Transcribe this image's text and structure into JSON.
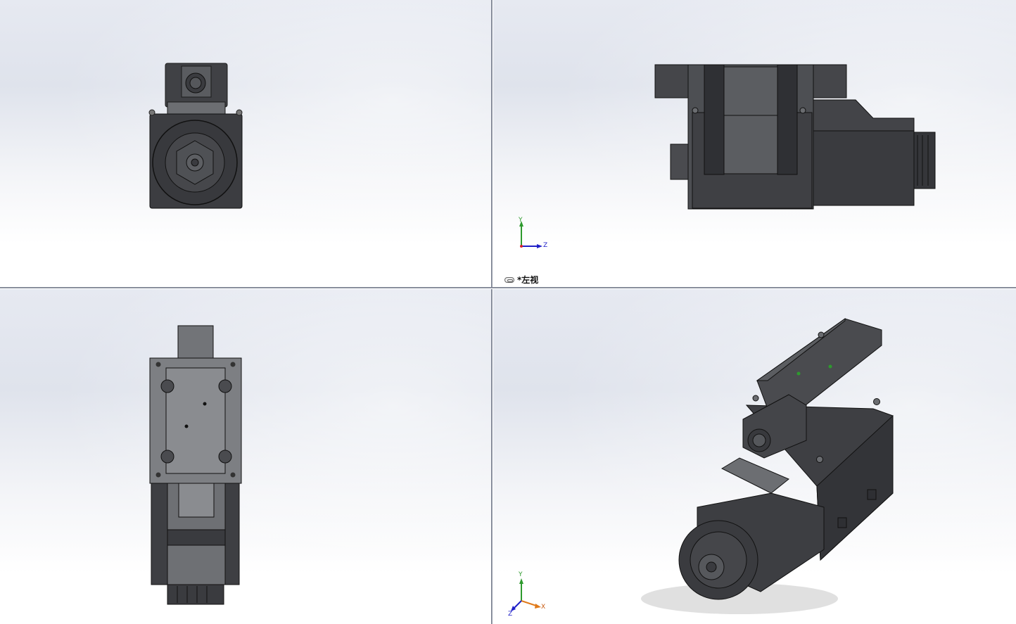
{
  "viewports": {
    "top_left": {
      "view": "front"
    },
    "top_right": {
      "view": "left",
      "label": "*左视",
      "triad": {
        "axes": [
          "Y",
          "Z"
        ]
      }
    },
    "bottom_left": {
      "view": "top"
    },
    "bottom_right": {
      "view": "isometric",
      "triad": {
        "axes": [
          "Y",
          "X",
          "Z"
        ]
      }
    }
  },
  "colors": {
    "part_dark": "#3f4044",
    "part_mid": "#56585d",
    "part_light": "#6b6d72",
    "face_grey": "#86888c",
    "background_top": "#e6e9f1",
    "background_bottom": "#ffffff",
    "splitter": "#9aa0ad",
    "axis_x": "#d8202a",
    "axis_y": "#2e9a2e",
    "axis_z": "#2020c8"
  },
  "icons": {
    "view_link": "link-icon"
  }
}
